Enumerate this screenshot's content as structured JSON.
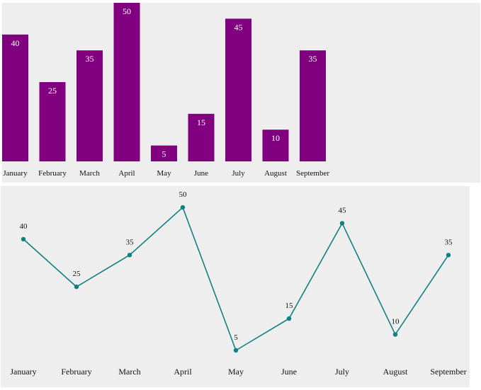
{
  "chart_data": [
    {
      "type": "bar",
      "categories": [
        "January",
        "February",
        "March",
        "April",
        "May",
        "June",
        "July",
        "August",
        "September"
      ],
      "values": [
        40,
        25,
        35,
        50,
        5,
        15,
        45,
        10,
        35
      ],
      "ylim": [
        0,
        50
      ],
      "color": "#800080"
    },
    {
      "type": "line",
      "categories": [
        "January",
        "February",
        "March",
        "April",
        "May",
        "June",
        "July",
        "August",
        "September"
      ],
      "values": [
        40,
        25,
        35,
        50,
        5,
        15,
        45,
        10,
        35
      ],
      "ylim": [
        5,
        50
      ],
      "color": "#108080"
    }
  ]
}
